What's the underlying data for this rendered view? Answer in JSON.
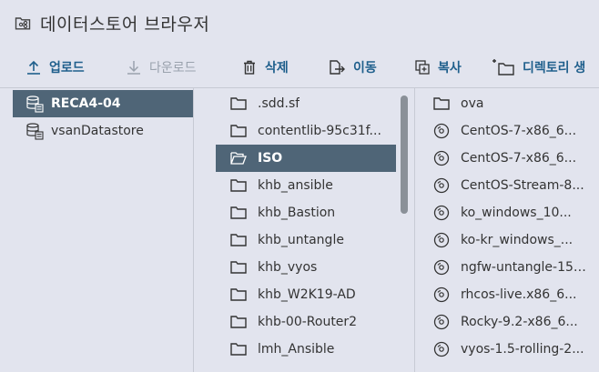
{
  "window": {
    "title": "데이터스토어 브라우저"
  },
  "toolbar": {
    "upload": "업로드",
    "download": "다운로드",
    "delete": "삭제",
    "move": "이동",
    "copy": "복사",
    "new_folder": "디렉토리 생"
  },
  "datastores": [
    {
      "name": "RECA4-04",
      "selected": true
    },
    {
      "name": "vsanDatastore",
      "selected": false
    }
  ],
  "folders": [
    {
      "name": ".sdd.sf",
      "selected": false
    },
    {
      "name": "contentlib-95c31f...",
      "selected": false
    },
    {
      "name": "ISO",
      "selected": true
    },
    {
      "name": "khb_ansible",
      "selected": false
    },
    {
      "name": "khb_Bastion",
      "selected": false
    },
    {
      "name": "khb_untangle",
      "selected": false
    },
    {
      "name": "khb_vyos",
      "selected": false
    },
    {
      "name": "khb_W2K19-AD",
      "selected": false
    },
    {
      "name": "khb-00-Router2",
      "selected": false
    },
    {
      "name": "lmh_Ansible",
      "selected": false
    }
  ],
  "files": [
    {
      "name": "ova",
      "icon": "folder-icon"
    },
    {
      "name": "CentOS-7-x86_6...",
      "icon": "disc-icon"
    },
    {
      "name": "CentOS-7-x86_6...",
      "icon": "disc-icon"
    },
    {
      "name": "CentOS-Stream-8...",
      "icon": "disc-icon"
    },
    {
      "name": "ko_windows_10...",
      "icon": "disc-icon"
    },
    {
      "name": "ko-kr_windows_...",
      "icon": "disc-icon"
    },
    {
      "name": "ngfw-untangle-15....",
      "icon": "disc-icon"
    },
    {
      "name": "rhcos-live.x86_6...",
      "icon": "disc-icon"
    },
    {
      "name": "Rocky-9.2-x86_6...",
      "icon": "disc-icon"
    },
    {
      "name": "vyos-1.5-rolling-2...",
      "icon": "disc-icon"
    }
  ]
}
